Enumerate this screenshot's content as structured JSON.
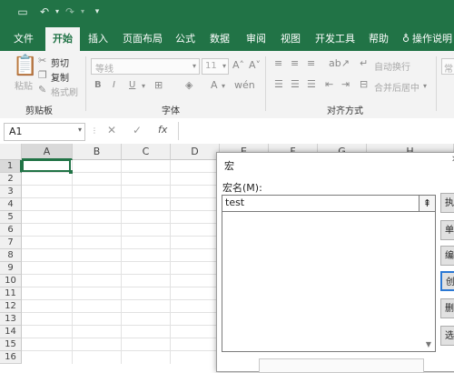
{
  "quick_access": {
    "icons": [
      "save-icon",
      "undo-icon",
      "redo-icon",
      "customize-icon"
    ]
  },
  "tabs": [
    {
      "label": "文件",
      "active": false
    },
    {
      "label": "开始",
      "active": true
    },
    {
      "label": "插入",
      "active": false
    },
    {
      "label": "页面布局",
      "active": false
    },
    {
      "label": "公式",
      "active": false
    },
    {
      "label": "数据",
      "active": false
    },
    {
      "label": "审阅",
      "active": false
    },
    {
      "label": "视图",
      "active": false
    },
    {
      "label": "开发工具",
      "active": false
    },
    {
      "label": "帮助",
      "active": false
    },
    {
      "label": "操作说明",
      "active": false
    }
  ],
  "ribbon": {
    "paste": "粘贴",
    "cut": "剪切",
    "copy": "复制",
    "format_painter": "格式刷",
    "clipboard": "剪贴板",
    "font_name": "等线",
    "font_size": "11",
    "bold": "B",
    "italic": "I",
    "underline": "U",
    "font": "字体",
    "wrap_text": "自动换行",
    "merge_center": "合并后居中",
    "alignment": "对齐方式",
    "number_format": "常"
  },
  "formula_bar": {
    "name_box": "A1",
    "cancel": "✕",
    "enter": "✓",
    "fx": "fx"
  },
  "columns": [
    "A",
    "B",
    "C",
    "D",
    "E",
    "F",
    "G",
    "H"
  ],
  "rows": [
    "1",
    "2",
    "3",
    "4",
    "5",
    "6",
    "7",
    "8",
    "9",
    "10",
    "11",
    "12",
    "13",
    "14",
    "15",
    "16"
  ],
  "dialog": {
    "title": "宏",
    "macro_name_label": "宏名(M):",
    "macro_name_value": "test",
    "upload_symbol": "⇞",
    "buttons": [
      "执",
      "单",
      "编",
      "创",
      "删",
      "选"
    ]
  }
}
